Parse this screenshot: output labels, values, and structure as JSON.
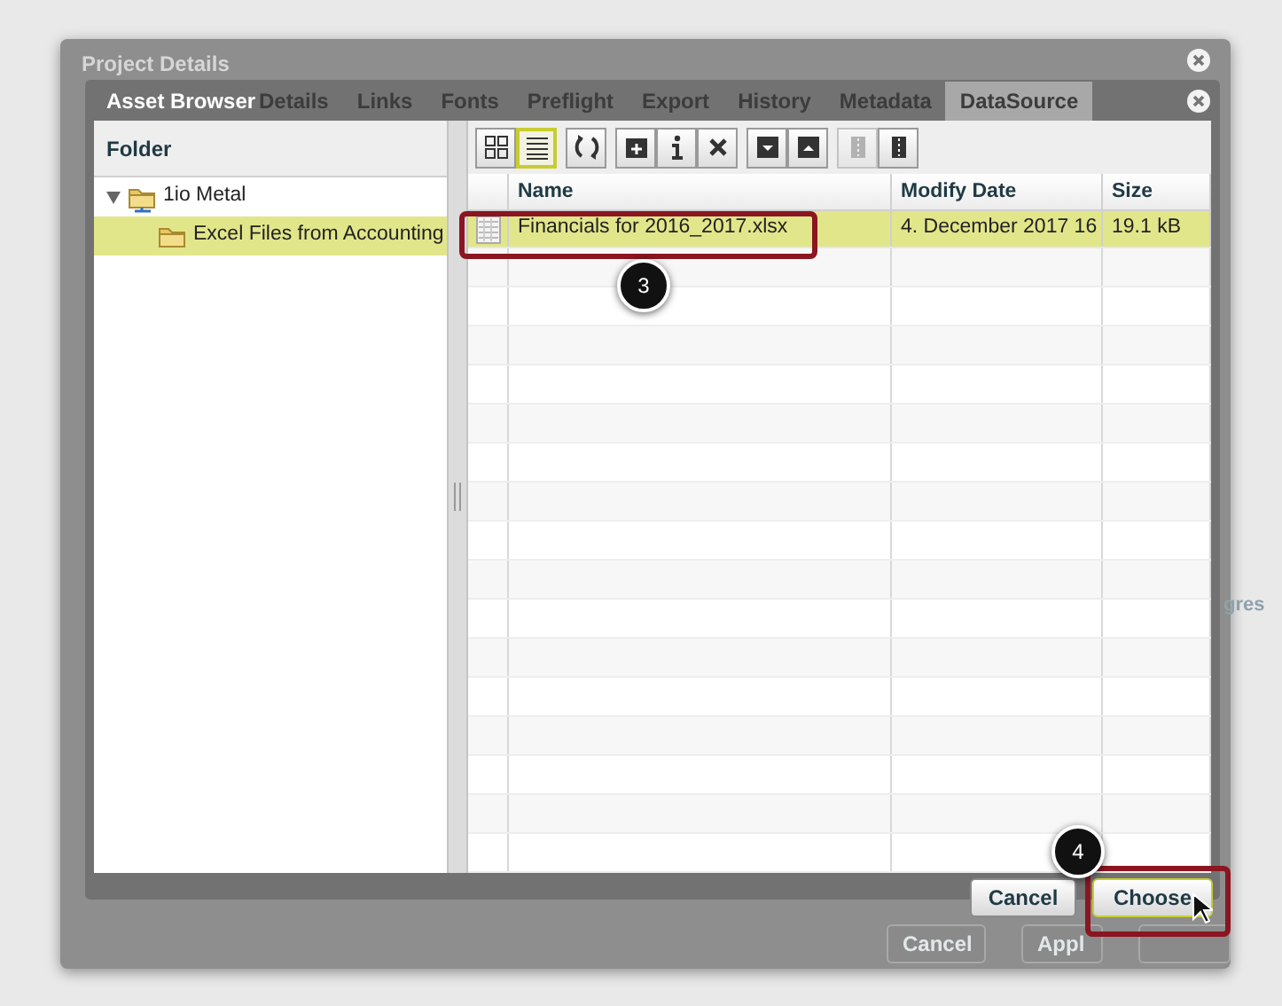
{
  "project_dialog": {
    "title": "Project Details",
    "tabs": [
      {
        "label": "Details",
        "selected": false
      },
      {
        "label": "Links",
        "selected": false
      },
      {
        "label": "Fonts",
        "selected": false
      },
      {
        "label": "Preflight",
        "selected": false
      },
      {
        "label": "Export",
        "selected": false
      },
      {
        "label": "History",
        "selected": false
      },
      {
        "label": "Metadata",
        "selected": false
      },
      {
        "label": "DataSource",
        "selected": true
      }
    ],
    "side_text": "gres",
    "buttons": [
      "Cancel",
      "Appl"
    ]
  },
  "asset_browser": {
    "title": "Asset Browser",
    "folder_header": "Folder",
    "tree": [
      {
        "label": "1io Metal",
        "kind": "server",
        "expanded": true,
        "selected": false,
        "children": [
          {
            "label": "Excel Files from Accounting",
            "kind": "folder",
            "selected": true
          }
        ]
      }
    ],
    "toolbar": [
      {
        "kind": "grid",
        "selected": false
      },
      {
        "kind": "list",
        "selected": true
      },
      {
        "kind": "refresh",
        "selected": false
      },
      {
        "kind": "new-folder",
        "selected": false
      },
      {
        "kind": "info",
        "selected": false
      },
      {
        "kind": "delete",
        "selected": false
      },
      {
        "kind": "download",
        "selected": false
      },
      {
        "kind": "upload",
        "selected": false
      },
      {
        "kind": "zip-out",
        "selected": false,
        "disabled": true
      },
      {
        "kind": "zip",
        "selected": false,
        "disabled": false
      }
    ],
    "columns": [
      "Name",
      "Modify Date",
      "Size"
    ],
    "rows": [
      {
        "selected": true,
        "cells": [
          "Financials for 2016_2017.xlsx",
          "4. December 2017 16",
          "19.1 kB"
        ]
      }
    ],
    "buttons": [
      {
        "label": "Cancel",
        "focused": false
      },
      {
        "label": "Choose",
        "focused": true
      }
    ]
  },
  "callouts": [
    {
      "label": "3"
    },
    {
      "label": "4"
    }
  ]
}
